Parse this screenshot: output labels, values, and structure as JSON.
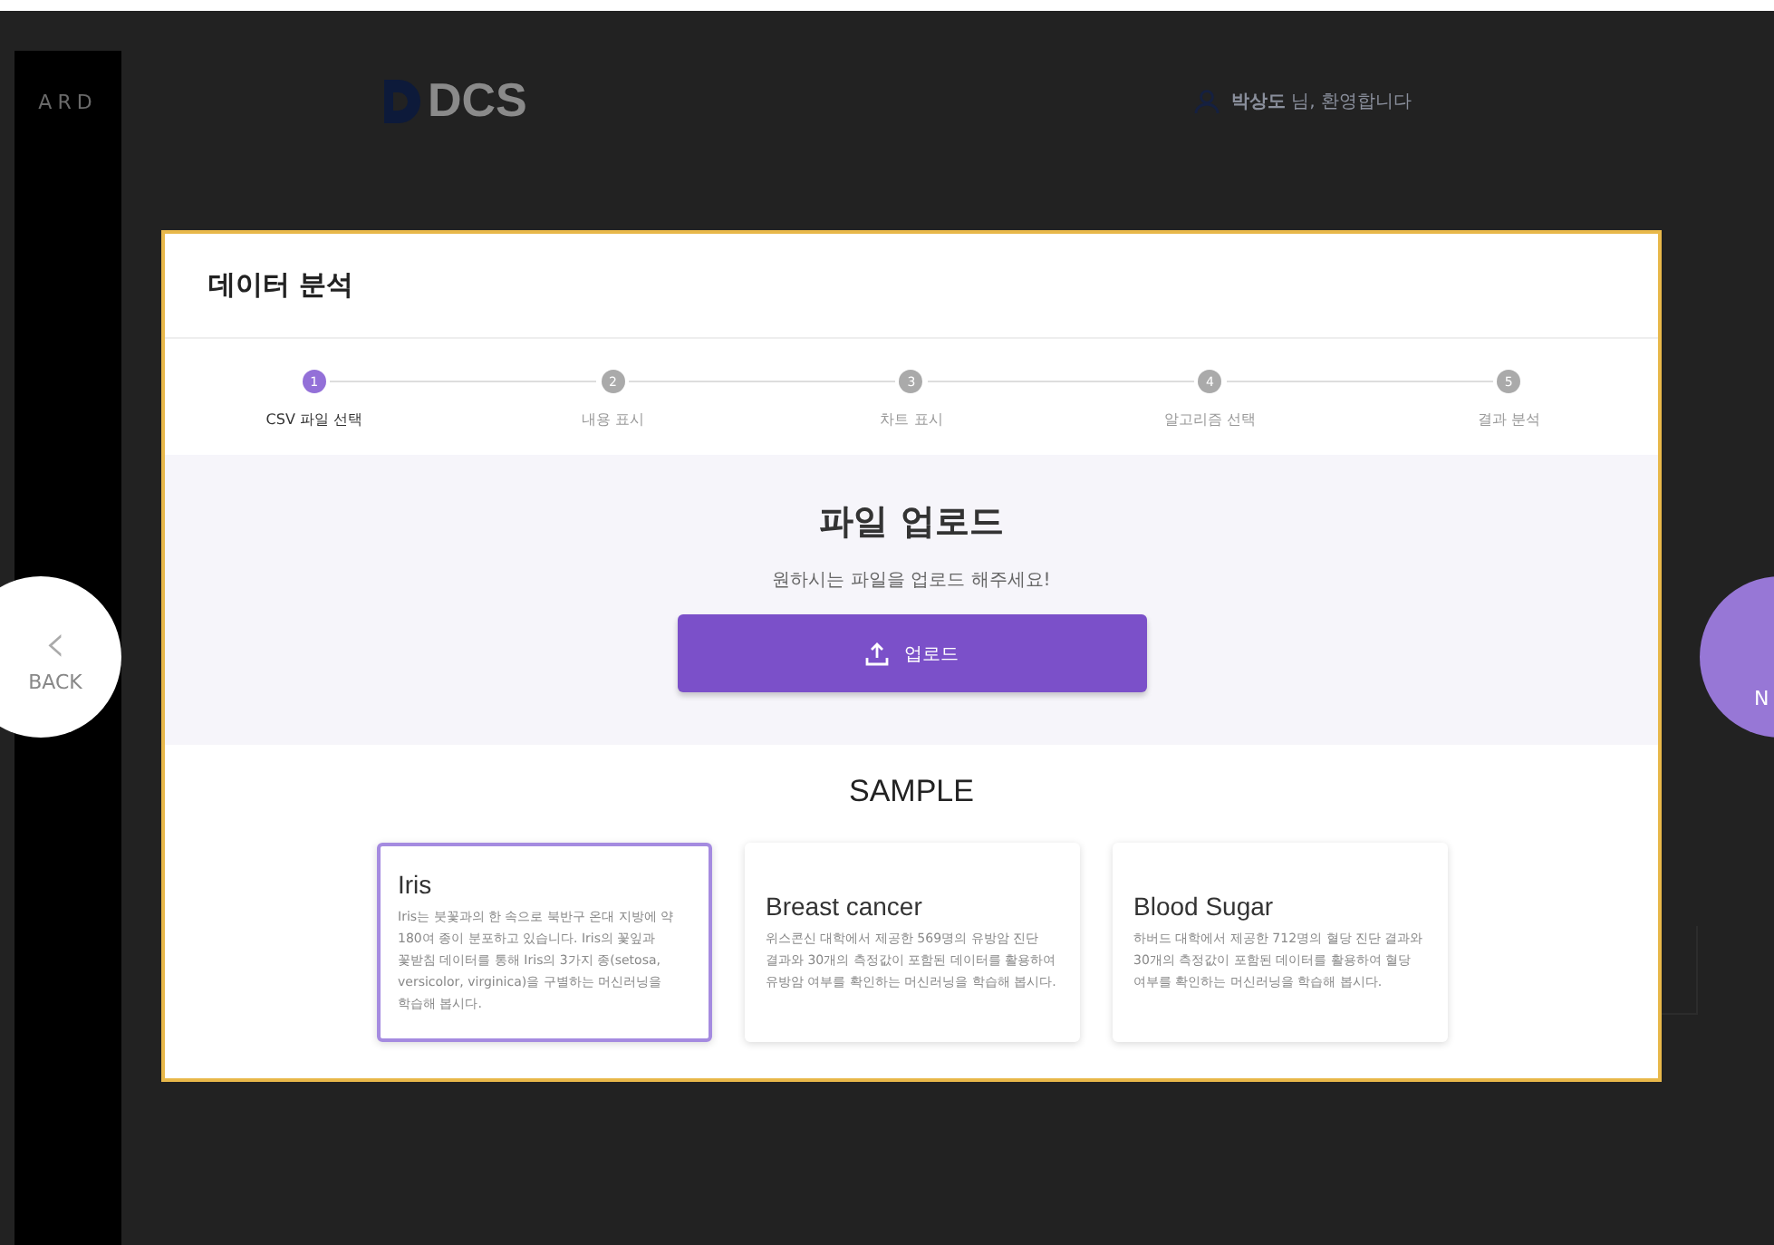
{
  "sidebar": {
    "label": "ARD"
  },
  "header": {
    "logo": "DCS",
    "user_name": "박상도",
    "greeting": " 님, 환영합니다"
  },
  "nav": {
    "back": {
      "icon": "‹",
      "label": "BACK"
    },
    "next": {
      "label": "N"
    }
  },
  "modal": {
    "title": "데이터 분석",
    "steps": [
      {
        "number": "1",
        "label": "CSV 파일 선택",
        "selected": true
      },
      {
        "number": "2",
        "label": "내용 표시",
        "selected": false
      },
      {
        "number": "3",
        "label": "차트 표시",
        "selected": false
      },
      {
        "number": "4",
        "label": "알고리즘 선택",
        "selected": false
      },
      {
        "number": "5",
        "label": "결과 분석",
        "selected": false
      }
    ],
    "upload": {
      "title": "파일 업로드",
      "subtitle": "원하시는 파일을 업로드 해주세요!",
      "button": "업로드"
    },
    "sample": {
      "title": "SAMPLE",
      "cards": [
        {
          "title": "Iris",
          "description": "Iris는 붓꽃과의 한 속으로 북반구 온대 지방에 약 180여 종이 분포하고 있습니다. Iris의 꽃잎과 꽃받침 데이터를 통해 Iris의 3가지 종(setosa, versicolor, virginica)을 구별하는 머신러닝을 학습해 봅시다.",
          "selected": true
        },
        {
          "title": "Breast cancer",
          "description": "위스콘신 대학에서 제공한 569명의 유방암 진단 결과와 30개의 측정값이 포함된 데이터를 활용하여 유방암 여부를 확인하는 머신러닝을 학습해 봅시다.",
          "selected": false
        },
        {
          "title": "Blood Sugar",
          "description": "하버드 대학에서 제공한 712명의 혈당 진단 결과와 30개의 측정값이 포함된 데이터를 활용하여 혈당 여부를 확인하는 머신러닝을 학습해 봅시다.",
          "selected": false
        }
      ]
    }
  }
}
